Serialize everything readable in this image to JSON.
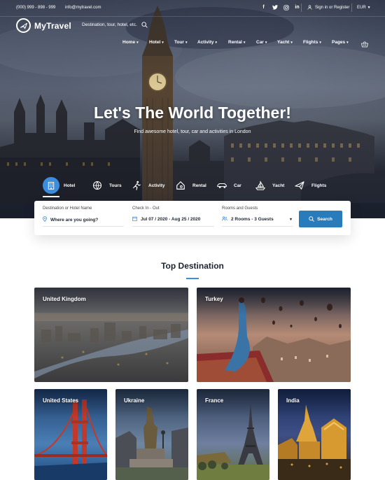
{
  "topbar": {
    "phone": "(000) 999 - 898 - 999",
    "email": "info@mytravel.com",
    "social": [
      {
        "icon": "facebook-icon",
        "glyph": "f"
      },
      {
        "icon": "twitter-icon",
        "glyph": "t"
      },
      {
        "icon": "instagram-icon",
        "glyph": "◎"
      },
      {
        "icon": "linkedin-icon",
        "glyph": "in"
      }
    ],
    "signin": "Sign in or Register",
    "currency": "EUR"
  },
  "header": {
    "brand": "MyTravel",
    "search_placeholder": "Destination, tour, hotel, etc.",
    "nav": [
      "Home",
      "Hotel",
      "Tour",
      "Activity",
      "Rental",
      "Car",
      "Yacht",
      "Flights",
      "Pages"
    ]
  },
  "hero": {
    "title": "Let's The World Together!",
    "subtitle": "Find awesome hotel, tour, car and activities in London"
  },
  "categories": [
    {
      "label": "Hotel",
      "icon": "hotel-icon"
    },
    {
      "label": "Tours",
      "icon": "tours-icon"
    },
    {
      "label": "Activity",
      "icon": "activity-icon"
    },
    {
      "label": "Rental",
      "icon": "rental-icon"
    },
    {
      "label": "Car",
      "icon": "car-icon"
    },
    {
      "label": "Yacht",
      "icon": "yacht-icon"
    },
    {
      "label": "Flights",
      "icon": "flights-icon"
    }
  ],
  "search": {
    "destination_label": "Destination or Hotel Name",
    "destination_placeholder": "Where are you going?",
    "dates_label": "Check In - Out",
    "dates_value": "Jul 07 / 2020 - Aug 25 / 2020",
    "rooms_label": "Rooms and Guests",
    "rooms_value": "2 Rooms - 3 Guests",
    "button": "Search"
  },
  "destinations": {
    "title": "Top Destination",
    "items": [
      "United Kingdom",
      "Turkey",
      "United States",
      "Ukraine",
      "France",
      "India"
    ]
  },
  "colors": {
    "accent": "#297cbb",
    "accent_light": "#3c8ddd"
  }
}
